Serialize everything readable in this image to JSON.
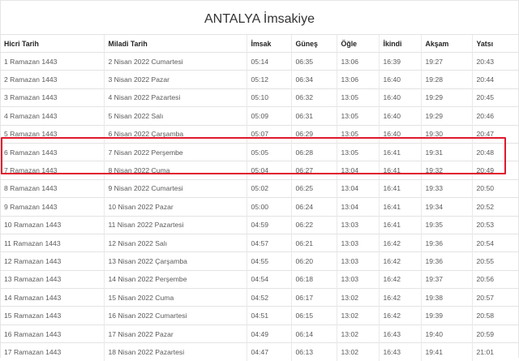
{
  "title": "ANTALYA İmsakiye",
  "columns": [
    "Hicri Tarih",
    "Miladi Tarih",
    "İmsak",
    "Güneş",
    "Öğle",
    "İkindi",
    "Akşam",
    "Yatsı"
  ],
  "rows": [
    [
      "1 Ramazan 1443",
      "2 Nisan 2022 Cumartesi",
      "05:14",
      "06:35",
      "13:06",
      "16:39",
      "19:27",
      "20:43"
    ],
    [
      "2 Ramazan 1443",
      "3 Nisan 2022 Pazar",
      "05:12",
      "06:34",
      "13:06",
      "16:40",
      "19:28",
      "20:44"
    ],
    [
      "3 Ramazan 1443",
      "4 Nisan 2022 Pazartesi",
      "05:10",
      "06:32",
      "13:05",
      "16:40",
      "19:29",
      "20:45"
    ],
    [
      "4 Ramazan 1443",
      "5 Nisan 2022 Salı",
      "05:09",
      "06:31",
      "13:05",
      "16:40",
      "19:29",
      "20:46"
    ],
    [
      "5 Ramazan 1443",
      "6 Nisan 2022 Çarşamba",
      "05:07",
      "06:29",
      "13:05",
      "16:40",
      "19:30",
      "20:47"
    ],
    [
      "6 Ramazan 1443",
      "7 Nisan 2022 Perşembe",
      "05:05",
      "06:28",
      "13:05",
      "16:41",
      "19:31",
      "20:48"
    ],
    [
      "7 Ramazan 1443",
      "8 Nisan 2022 Cuma",
      "05:04",
      "06:27",
      "13:04",
      "16:41",
      "19:32",
      "20:49"
    ],
    [
      "8 Ramazan 1443",
      "9 Nisan 2022 Cumartesi",
      "05:02",
      "06:25",
      "13:04",
      "16:41",
      "19:33",
      "20:50"
    ],
    [
      "9 Ramazan 1443",
      "10 Nisan 2022 Pazar",
      "05:00",
      "06:24",
      "13:04",
      "16:41",
      "19:34",
      "20:52"
    ],
    [
      "10 Ramazan 1443",
      "11 Nisan 2022 Pazartesi",
      "04:59",
      "06:22",
      "13:03",
      "16:41",
      "19:35",
      "20:53"
    ],
    [
      "11 Ramazan 1443",
      "12 Nisan 2022 Salı",
      "04:57",
      "06:21",
      "13:03",
      "16:42",
      "19:36",
      "20:54"
    ],
    [
      "12 Ramazan 1443",
      "13 Nisan 2022 Çarşamba",
      "04:55",
      "06:20",
      "13:03",
      "16:42",
      "19:36",
      "20:55"
    ],
    [
      "13 Ramazan 1443",
      "14 Nisan 2022 Perşembe",
      "04:54",
      "06:18",
      "13:03",
      "16:42",
      "19:37",
      "20:56"
    ],
    [
      "14 Ramazan 1443",
      "15 Nisan 2022 Cuma",
      "04:52",
      "06:17",
      "13:02",
      "16:42",
      "19:38",
      "20:57"
    ],
    [
      "15 Ramazan 1443",
      "16 Nisan 2022 Cumartesi",
      "04:51",
      "06:15",
      "13:02",
      "16:42",
      "19:39",
      "20:58"
    ],
    [
      "16 Ramazan 1443",
      "17 Nisan 2022 Pazar",
      "04:49",
      "06:14",
      "13:02",
      "16:43",
      "19:40",
      "20:59"
    ],
    [
      "17 Ramazan 1443",
      "18 Nisan 2022 Pazartesi",
      "04:47",
      "06:13",
      "13:02",
      "16:43",
      "19:41",
      "21:01"
    ]
  ],
  "highlight": {
    "rows": [
      6,
      7
    ],
    "color": "#e0182d"
  }
}
